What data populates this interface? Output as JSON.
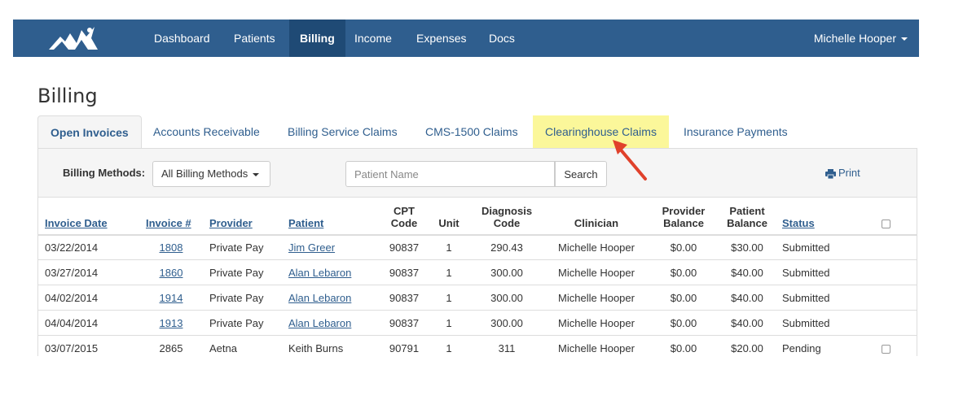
{
  "nav": {
    "items": [
      {
        "label": "Dashboard",
        "active": false
      },
      {
        "label": "Patients",
        "active": false
      },
      {
        "label": "Billing",
        "active": true
      },
      {
        "label": "Income",
        "active": false
      },
      {
        "label": "Expenses",
        "active": false
      },
      {
        "label": "Docs",
        "active": false
      }
    ],
    "user": "Michelle Hooper"
  },
  "page": {
    "title": "Billing"
  },
  "tabs": [
    {
      "label": "Open Invoices",
      "active": true
    },
    {
      "label": "Accounts Receivable"
    },
    {
      "label": "Billing Service Claims"
    },
    {
      "label": "CMS-1500 Claims"
    },
    {
      "label": "Clearinghouse Claims",
      "highlighted": true
    },
    {
      "label": "Insurance Payments"
    }
  ],
  "toolbar": {
    "billing_methods_label": "Billing Methods:",
    "billing_methods_value": "All Billing Methods",
    "patient_placeholder": "Patient Name",
    "search_label": "Search",
    "print_label": "Print"
  },
  "table": {
    "columns": [
      "Invoice Date",
      "Invoice #",
      "Provider",
      "Patient",
      "CPT Code",
      "Unit",
      "Diagnosis Code",
      "Clinician",
      "Provider Balance",
      "Patient Balance",
      "Status"
    ],
    "headers": {
      "invoice_date": "Invoice Date",
      "invoice_num": "Invoice #",
      "provider": "Provider",
      "patient": "Patient",
      "cpt_1": "CPT",
      "cpt_2": "Code",
      "unit": "Unit",
      "diag_1": "Diagnosis",
      "diag_2": "Code",
      "clinician": "Clinician",
      "prov_bal_1": "Provider",
      "prov_bal_2": "Balance",
      "pat_bal_1": "Patient",
      "pat_bal_2": "Balance",
      "status": "Status"
    },
    "rows": [
      {
        "date": "03/22/2014",
        "invoice": "1808",
        "provider": "Private Pay",
        "patient": "Jim Greer",
        "cpt": "90837",
        "unit": "1",
        "diagnosis": "290.43",
        "clinician": "Michelle Hooper",
        "provider_balance": "$0.00",
        "patient_balance": "$30.00",
        "status": "Submitted",
        "linked": true,
        "checkbox": false
      },
      {
        "date": "03/27/2014",
        "invoice": "1860",
        "provider": "Private Pay",
        "patient": "Alan Lebaron",
        "cpt": "90837",
        "unit": "1",
        "diagnosis": "300.00",
        "clinician": "Michelle Hooper",
        "provider_balance": "$0.00",
        "patient_balance": "$40.00",
        "status": "Submitted",
        "linked": true,
        "checkbox": false
      },
      {
        "date": "04/02/2014",
        "invoice": "1914",
        "provider": "Private Pay",
        "patient": "Alan Lebaron",
        "cpt": "90837",
        "unit": "1",
        "diagnosis": "300.00",
        "clinician": "Michelle Hooper",
        "provider_balance": "$0.00",
        "patient_balance": "$40.00",
        "status": "Submitted",
        "linked": true,
        "checkbox": false
      },
      {
        "date": "04/04/2014",
        "invoice": "1913",
        "provider": "Private Pay",
        "patient": "Alan Lebaron",
        "cpt": "90837",
        "unit": "1",
        "diagnosis": "300.00",
        "clinician": "Michelle Hooper",
        "provider_balance": "$0.00",
        "patient_balance": "$40.00",
        "status": "Submitted",
        "linked": true,
        "checkbox": false
      },
      {
        "date": "03/07/2015",
        "invoice": "2865",
        "provider": "Aetna",
        "patient": "Keith Burns",
        "cpt": "90791",
        "unit": "1",
        "diagnosis": "311",
        "clinician": "Michelle Hooper",
        "provider_balance": "$0.00",
        "patient_balance": "$20.00",
        "status": "Pending",
        "linked": false,
        "checkbox": true
      }
    ]
  },
  "colors": {
    "navbar": "#2f5e8e",
    "navbar_active": "#1f4a75",
    "link": "#2f5e8e",
    "highlight": "#fbf79a",
    "arrow": "#e0412b"
  },
  "icons": {
    "print": "printer-icon",
    "arrow": "red-arrow-annotation"
  }
}
